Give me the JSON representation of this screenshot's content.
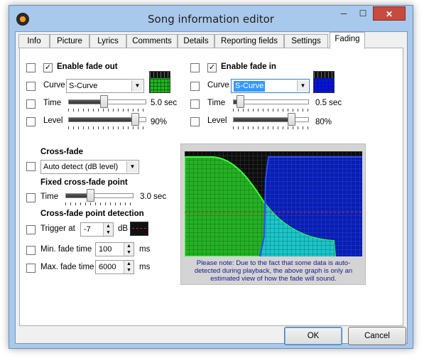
{
  "window": {
    "title": "Song information editor",
    "close_glyph": "✕",
    "min_glyph": "─",
    "max_glyph": "☐"
  },
  "tabs": [
    {
      "label": "Info"
    },
    {
      "label": "Picture"
    },
    {
      "label": "Lyrics"
    },
    {
      "label": "Comments"
    },
    {
      "label": "Details"
    },
    {
      "label": "Reporting fields"
    },
    {
      "label": "Settings"
    },
    {
      "label": "Fading"
    }
  ],
  "active_tab": "Fading",
  "fade_out": {
    "enable_label": "Enable fade out",
    "enabled": true,
    "curve_label": "Curve",
    "curve_value": "S-Curve",
    "time_label": "Time",
    "time_value": "5.0 sec",
    "time_level": 0.45,
    "level_label": "Level",
    "level_value": "90%",
    "level_level": 0.9,
    "swatch_color": "#22b522"
  },
  "fade_in": {
    "enable_label": "Enable fade in",
    "enabled": true,
    "curve_label": "Curve",
    "curve_value": "S-Curve",
    "time_label": "Time",
    "time_value": "0.5 sec",
    "time_level": 0.05,
    "level_label": "Level",
    "level_value": "80%",
    "level_level": 0.8,
    "swatch_color": "#0a1ea8"
  },
  "cross_fade": {
    "heading": "Cross-fade",
    "mode_value": "Auto detect (dB level)",
    "fixed_heading": "Fixed cross-fade point",
    "time_label": "Time",
    "time_value": "3.0 sec",
    "time_level": 0.35,
    "detect_heading": "Cross-fade point detection",
    "trigger_label": "Trigger at",
    "trigger_value": "-7",
    "trigger_unit": "dB",
    "min_label": "Min. fade time",
    "min_value": "100",
    "min_unit": "ms",
    "max_label": "Max. fade time",
    "max_value": "6000",
    "max_unit": "ms"
  },
  "graph_note": "Please note: Due to the fact that some data is auto-detected during playback, the above graph is only an estimated view of how the fade will sound.",
  "buttons": {
    "ok": "OK",
    "cancel": "Cancel"
  },
  "colors": {
    "fade_out": "#22b522",
    "fade_in": "#0a1ea8",
    "overlap": "#19c6c6",
    "threshold": "#e02020"
  }
}
